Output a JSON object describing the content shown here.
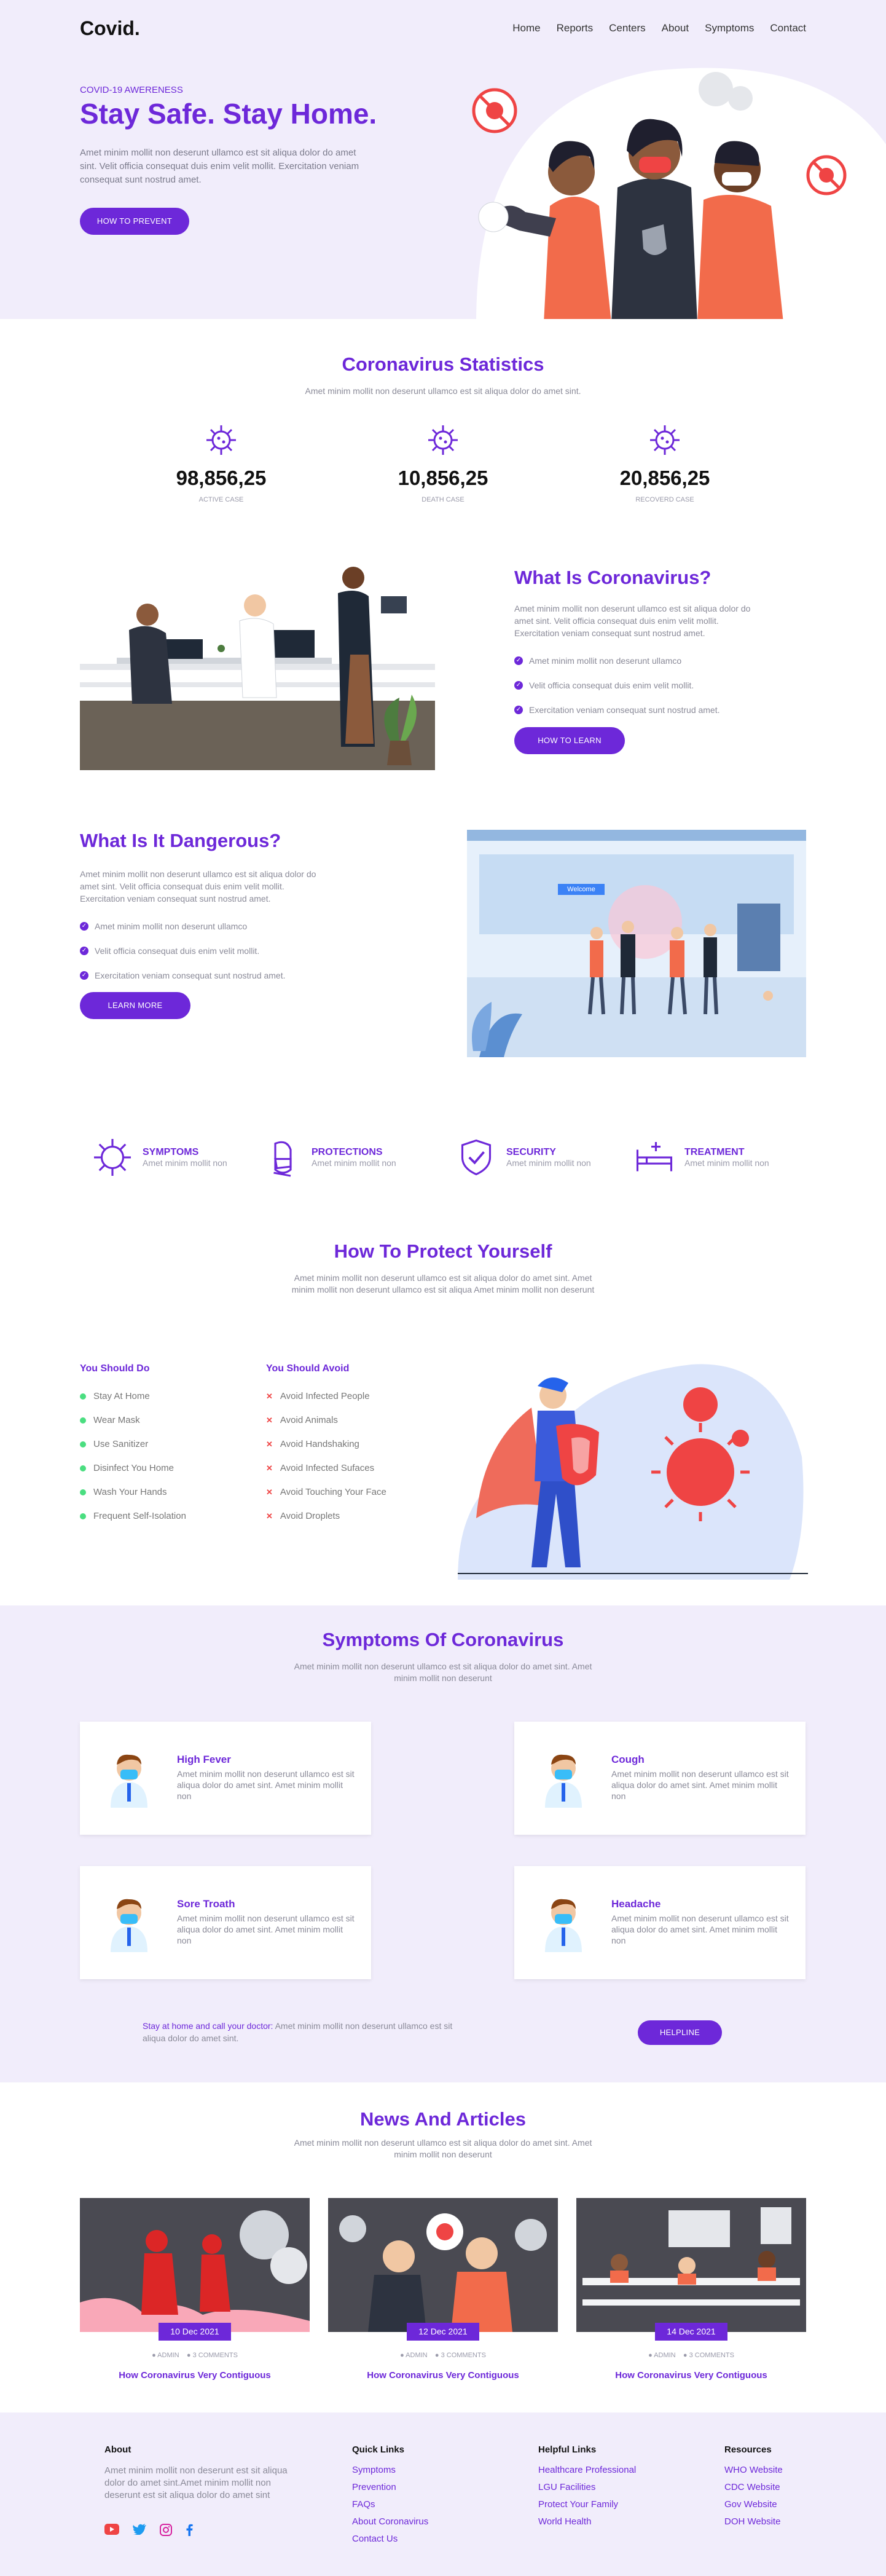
{
  "header": {
    "logo": "Covid.",
    "nav": [
      "Home",
      "Reports",
      "Centers",
      "About",
      "Symptoms",
      "Contact"
    ]
  },
  "hero": {
    "kicker": "COVID-19 AWERENESS",
    "title": "Stay Safe. Stay Home.",
    "text": "Amet minim mollit non deserunt ullamco est sit aliqua dolor do amet sint. Velit officia consequat duis enim velit mollit. Exercitation veniam consequat sunt nostrud amet.",
    "button": "HOW TO PREVENT"
  },
  "stats": {
    "title": "Coronavirus Statistics",
    "subtitle": "Amet minim mollit non deserunt ullamco est sit aliqua dolor do amet sint.",
    "items": [
      {
        "value": "98,856,25",
        "label": "ACTIVE CASE"
      },
      {
        "value": "10,856,25",
        "label": "DEATH CASE"
      },
      {
        "value": "20,856,25",
        "label": "RECOVERD CASE"
      }
    ]
  },
  "what_is": {
    "title": "What Is Coronavirus?",
    "text": "Amet minim mollit non deserunt ullamco est sit aliqua dolor do amet sint. Velit officia consequat duis enim velit mollit. Exercitation veniam consequat sunt nostrud amet.",
    "points": [
      "Amet minim mollit non deserunt ullamco",
      "Velit officia consequat duis enim velit mollit.",
      "Exercitation veniam consequat sunt nostrud amet."
    ],
    "button": "HOW TO LEARN"
  },
  "dangerous": {
    "title": "What Is It Dangerous?",
    "text": "Amet minim mollit non deserunt ullamco est sit aliqua dolor do amet sint. Velit officia consequat duis enim velit mollit. Exercitation veniam consequat sunt nostrud amet.",
    "points": [
      "Amet minim mollit non deserunt ullamco",
      "Velit officia consequat duis enim velit mollit.",
      "Exercitation veniam consequat sunt nostrud amet."
    ],
    "button": "LEARN MORE",
    "sign": "Welcome"
  },
  "services": [
    {
      "title": "SYMPTOMS",
      "text": "Amet minim mollit non",
      "icon": "virus-icon"
    },
    {
      "title": "PROTECTIONS",
      "text": "Amet minim mollit non",
      "icon": "masked-face-icon"
    },
    {
      "title": "SECURITY",
      "text": "Amet minim mollit non",
      "icon": "shield-check-icon"
    },
    {
      "title": "TREATMENT",
      "text": "Amet minim mollit non",
      "icon": "hospital-bed-icon"
    }
  ],
  "protect": {
    "title": "How To Protect Yourself",
    "subtitle": "Amet minim mollit non deserunt ullamco est sit aliqua dolor do amet sint. Amet minim mollit non deserunt ullamco est sit aliqua Amet minim mollit non deserunt",
    "do_title": "You Should Do",
    "do": [
      "Stay At Home",
      "Wear Mask",
      "Use Sanitizer",
      "Disinfect You Home",
      "Wash Your Hands",
      "Frequent Self-Isolation"
    ],
    "avoid_title": "You Should Avoid",
    "avoid": [
      "Avoid Infected People",
      "Avoid Animals",
      "Avoid Handshaking",
      "Avoid Infected Sufaces",
      "Avoid Touching Your Face",
      "Avoid Droplets"
    ]
  },
  "symptoms": {
    "title": "Symptoms Of Coronavirus",
    "subtitle": "Amet minim mollit non deserunt ullamco est sit aliqua dolor do amet sint. Amet minim mollit non deserunt",
    "cards": [
      {
        "title": "High Fever",
        "text": "Amet minim mollit non deserunt ullamco est sit aliqua dolor do amet sint. Amet minim mollit non"
      },
      {
        "title": "Cough",
        "text": "Amet minim mollit non deserunt ullamco est sit aliqua dolor do amet sint. Amet minim mollit non"
      },
      {
        "title": "Sore Troath",
        "text": "Amet minim mollit non deserunt ullamco est sit aliqua dolor do amet sint. Amet minim mollit non"
      },
      {
        "title": "Headache",
        "text": "Amet minim mollit non deserunt ullamco est sit aliqua dolor do amet sint. Amet minim mollit non"
      }
    ],
    "cta_lead": "Stay at home and call your doctor:",
    "cta_text": "Amet minim mollit non deserunt ullamco est sit aliqua dolor do amet sint.",
    "cta_button": "HELPLINE"
  },
  "news": {
    "title": "News And Articles",
    "subtitle": "Amet minim mollit non deserunt ullamco est sit aliqua dolor do amet sint. Amet minim mollit non deserunt",
    "articles": [
      {
        "date": "10 Dec 2021",
        "author": "ADMIN",
        "comments": "3 COMMENTS",
        "title": "How Coronavirus Very Contiguous"
      },
      {
        "date": "12 Dec 2021",
        "author": "ADMIN",
        "comments": "3 COMMENTS",
        "title": "How Coronavirus Very Contiguous"
      },
      {
        "date": "14 Dec 2021",
        "author": "ADMIN",
        "comments": "3 COMMENTS",
        "title": "How Coronavirus Very Contiguous"
      }
    ]
  },
  "footer": {
    "about_title": "About",
    "about_text": "Amet minim mollit non deserunt est sit aliqua dolor do amet sint.Amet minim mollit non deserunt est sit aliqua dolor do amet sint",
    "quick_title": "Quick Links",
    "quick": [
      "Symptoms",
      "Prevention",
      "FAQs",
      "About Coronavirus",
      "Contact Us"
    ],
    "helpful_title": "Helpful Links",
    "helpful": [
      "Healthcare Professional",
      "LGU Facilities",
      "Protect Your Family",
      "World Health"
    ],
    "resources_title": "Resources",
    "resources": [
      "WHO Website",
      "CDC Website",
      "Gov Website",
      "DOH Website"
    ],
    "social": [
      "youtube-icon",
      "twitter-icon",
      "instagram-icon",
      "facebook-icon"
    ]
  },
  "colors": {
    "accent": "#6d28d9",
    "tint": "#f1edfb",
    "virus": "#ef4444",
    "do_green": "#4ade80"
  }
}
